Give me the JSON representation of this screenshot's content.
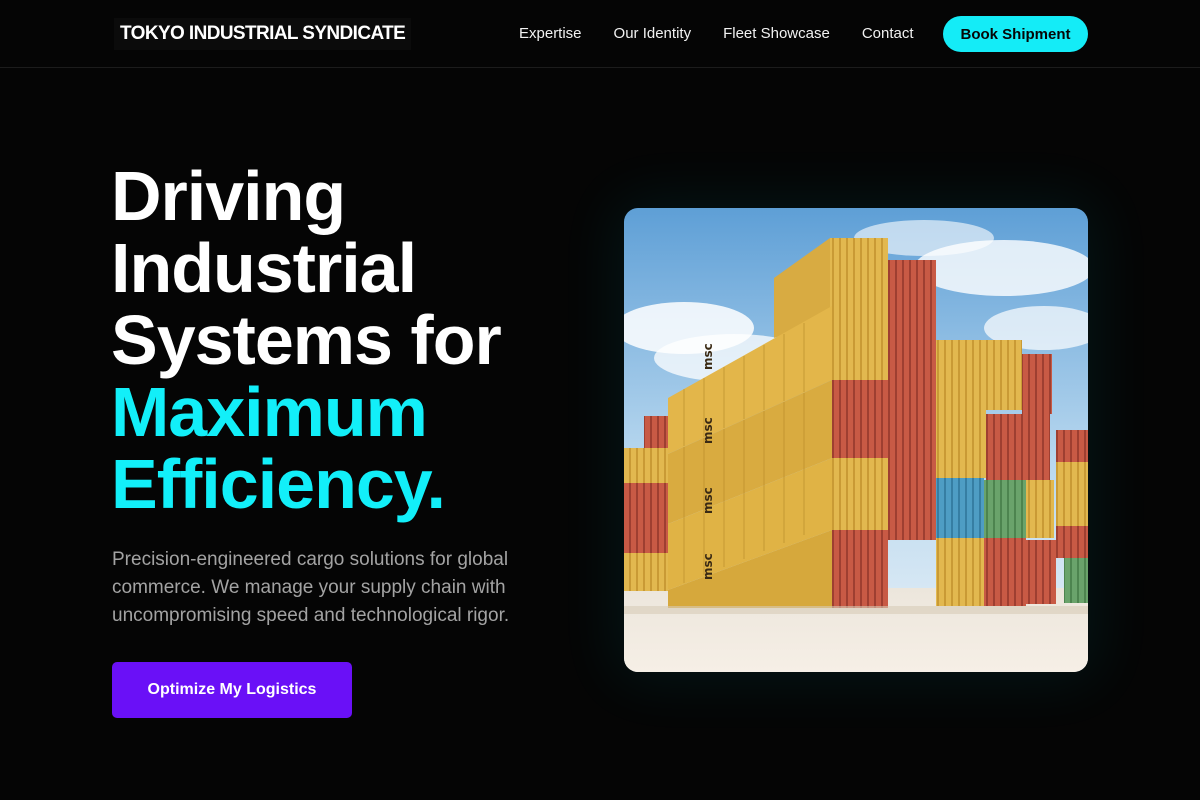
{
  "brand": {
    "name": "TOKYO INDUSTRIAL SYNDICATE"
  },
  "nav": {
    "links": [
      "Expertise",
      "Our Identity",
      "Fleet Showcase",
      "Contact"
    ],
    "cta_label": "Book Shipment"
  },
  "hero": {
    "headline_lines": [
      "Driving",
      "Industrial",
      "Systems for"
    ],
    "headline_accent_lines": [
      "Maximum",
      "Efficiency."
    ],
    "subtext": "Precision-engineered cargo solutions for global commerce. We manage your supply chain with uncompromising speed and technological rigor.",
    "cta_label": "Optimize My Logistics",
    "image_alt": "Stacked shipping containers under a blue sky",
    "container_marking": "msc"
  },
  "colors": {
    "background": "#050505",
    "accent_cyan": "#12eff9",
    "cta_purple": "#6a10f7",
    "muted_text": "#a3a3a3"
  }
}
